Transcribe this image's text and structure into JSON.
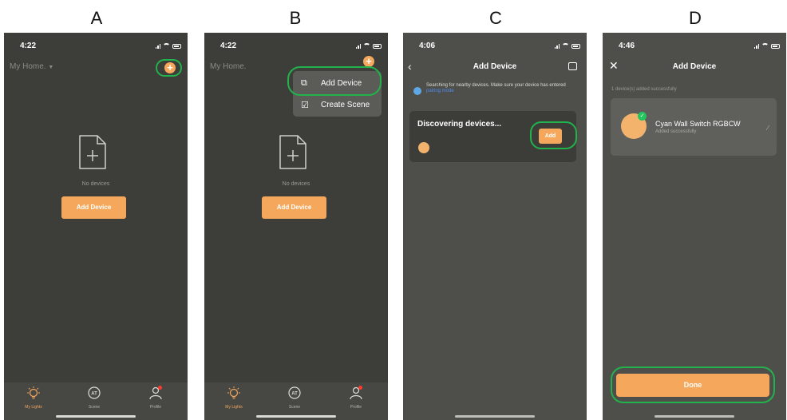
{
  "panels": [
    {
      "label": "A"
    },
    {
      "label": "B"
    },
    {
      "label": "C"
    },
    {
      "label": "D"
    }
  ],
  "panel_a": {
    "time": "4:22",
    "home_title": "My Home.",
    "no_devices": "No devices",
    "add_device_button": "Add Device",
    "tabs": [
      "My Lights",
      "Scene",
      "Profile"
    ]
  },
  "panel_b": {
    "time": "4:22",
    "home_title": "My Home.",
    "menu": [
      "Add Device",
      "Create Scene"
    ],
    "no_devices": "No devices",
    "add_device_button": "Add Device",
    "tabs": [
      "My Lights",
      "Scene",
      "Profile"
    ]
  },
  "panel_c": {
    "time": "4:06",
    "title": "Add Device",
    "searching_text": "Searching for nearby devices. Make sure your device has entered",
    "pairing_link": "pairing mode",
    "discovering": "Discovering devices...",
    "add_button": "Add"
  },
  "panel_d": {
    "time": "4:46",
    "title": "Add Device",
    "added_count": "1 device(s) added successfully",
    "device_name": "Cyan Wall Switch RGBCW",
    "device_status": "Added successfully",
    "done_button": "Done"
  },
  "colors": {
    "accent": "#f5a85b",
    "highlight": "#22b24c",
    "screen_dark": "#3d3d3a",
    "screen_gray": "#4e4e4b"
  },
  "icons": {
    "add": "plus-circle-icon",
    "empty": "file-plus-icon",
    "tab_lights": "bulb-icon",
    "tab_scene": "scene-icon",
    "tab_profile": "person-icon"
  }
}
